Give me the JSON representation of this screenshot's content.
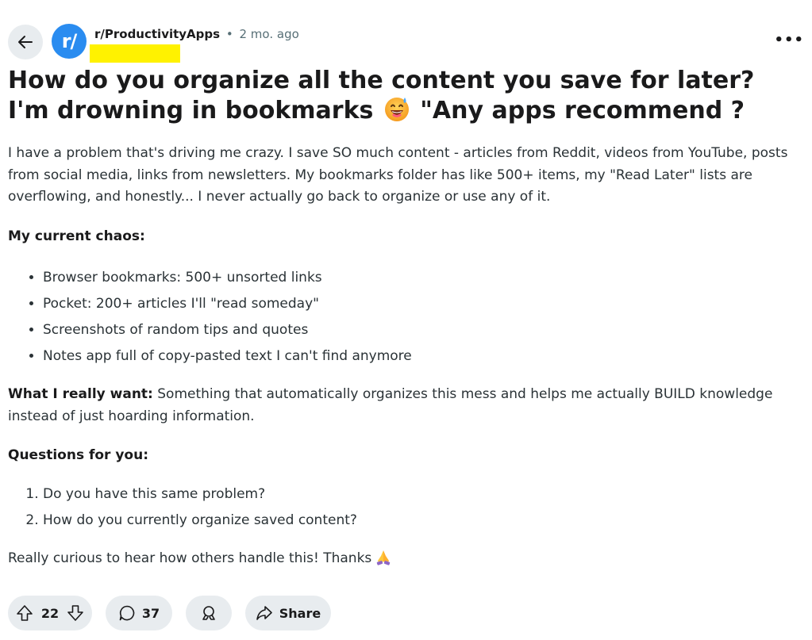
{
  "header": {
    "subreddit": "r/ProductivityApps",
    "separator": "•",
    "age": "2 mo. ago",
    "avatar_text": "r/",
    "more_label": "•••"
  },
  "post": {
    "title_part1": "How do you organize all the content you save for later? I'm drowning in bookmarks ",
    "title_part2": " \"Any apps recommend ?",
    "intro": "I have a problem that's driving me crazy. I save SO much content - articles from Reddit, videos from YouTube, posts from social media, links from newsletters. My bookmarks folder has like 500+ items, my \"Read Later\" lists are overflowing, and honestly... I never actually go back to organize or use any of it.",
    "chaos_heading": "My current chaos:",
    "chaos_items": [
      "Browser bookmarks: 500+ unsorted links",
      "Pocket: 200+ articles I'll \"read someday\"",
      "Screenshots of random tips and quotes",
      "Notes app full of copy-pasted text I can't find anymore"
    ],
    "want_label": "What I really want:",
    "want_text": " Something that automatically organizes this mess and helps me actually BUILD knowledge instead of just hoarding information.",
    "questions_heading": "Questions for you:",
    "questions": [
      "Do you have this same problem?",
      "How do you currently organize saved content?"
    ],
    "closing": "Really curious to hear how others handle this! Thanks"
  },
  "actions": {
    "upvotes": "22",
    "comments": "37",
    "share_label": "Share"
  },
  "colors": {
    "avatar_bg": "#2a8cf0",
    "highlight": "#fff200",
    "pill_bg": "#e8ecef",
    "muted_text": "#576f76"
  }
}
